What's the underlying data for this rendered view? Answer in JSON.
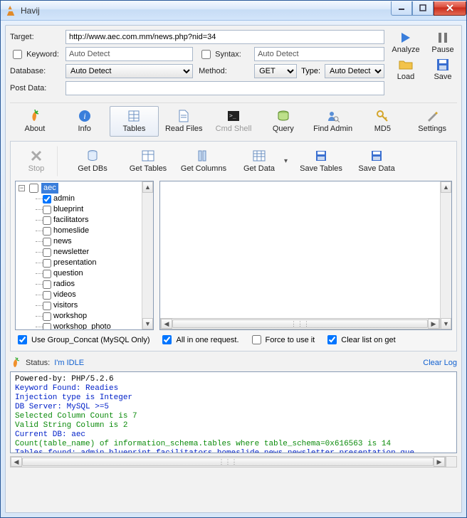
{
  "window": {
    "title": "Havij"
  },
  "win_buttons": {
    "min": "–",
    "max": "□",
    "close": "×"
  },
  "form": {
    "target_label": "Target:",
    "target_value": "http://www.aec.com.mm/news.php?nid=34",
    "keyword_label": "Keyword:",
    "keyword_value": "Auto Detect",
    "syntax_label": "Syntax:",
    "syntax_value": "Auto Detect",
    "database_label": "Database:",
    "database_value": "Auto Detect",
    "method_label": "Method:",
    "method_value": "GET",
    "type_label": "Type:",
    "type_value": "Auto Detect",
    "postdata_label": "Post Data:",
    "postdata_value": ""
  },
  "actions": {
    "analyze": "Analyze",
    "pause": "Pause",
    "load": "Load",
    "save": "Save"
  },
  "toolbar": {
    "about": "About",
    "info": "Info",
    "tables": "Tables",
    "readfiles": "Read Files",
    "cmdshell": "Cmd Shell",
    "query": "Query",
    "findadmin": "Find Admin",
    "md5": "MD5",
    "settings": "Settings"
  },
  "subtoolbar": {
    "stop": "Stop",
    "getdbs": "Get DBs",
    "gettables": "Get Tables",
    "getcolumns": "Get Columns",
    "getdata": "Get Data",
    "savetables": "Save Tables",
    "savedata": "Save Data"
  },
  "tree": {
    "db": "aec",
    "items": [
      {
        "label": "admin",
        "checked": true
      },
      {
        "label": "blueprint",
        "checked": false
      },
      {
        "label": "facilitators",
        "checked": false
      },
      {
        "label": "homeslide",
        "checked": false
      },
      {
        "label": "news",
        "checked": false
      },
      {
        "label": "newsletter",
        "checked": false
      },
      {
        "label": "presentation",
        "checked": false
      },
      {
        "label": "question",
        "checked": false
      },
      {
        "label": "radios",
        "checked": false
      },
      {
        "label": "videos",
        "checked": false
      },
      {
        "label": "visitors",
        "checked": false
      },
      {
        "label": "workshop",
        "checked": false
      },
      {
        "label": "workshop_photo",
        "checked": false
      }
    ]
  },
  "options": {
    "group_concat": "Use Group_Concat (MySQL Only)",
    "all_in_one": "All in one request.",
    "force": "Force to use it",
    "clear_list": "Clear list on get"
  },
  "status": {
    "label": "Status:",
    "value": "I'm IDLE",
    "clear": "Clear Log"
  },
  "log": [
    {
      "cls": "c-black",
      "text": "Powered-by: PHP/5.2.6"
    },
    {
      "cls": "c-blue",
      "text": "Keyword Found: Readies"
    },
    {
      "cls": "c-blue",
      "text": "Injection type is Integer"
    },
    {
      "cls": "c-blue",
      "text": "DB Server: MySQL >=5"
    },
    {
      "cls": "c-green",
      "text": "Selected Column Count is 7"
    },
    {
      "cls": "c-green",
      "text": "Valid String Column is 2"
    },
    {
      "cls": "c-blue",
      "text": "Current DB: aec"
    },
    {
      "cls": "c-green",
      "text": "Count(table_name) of information_schema.tables where table_schema=0x616563 is 14"
    },
    {
      "cls": "c-blue",
      "text": "Tables found: admin,blueprint,facilitators,homeslide,news,newsletter,presentation,que"
    }
  ]
}
